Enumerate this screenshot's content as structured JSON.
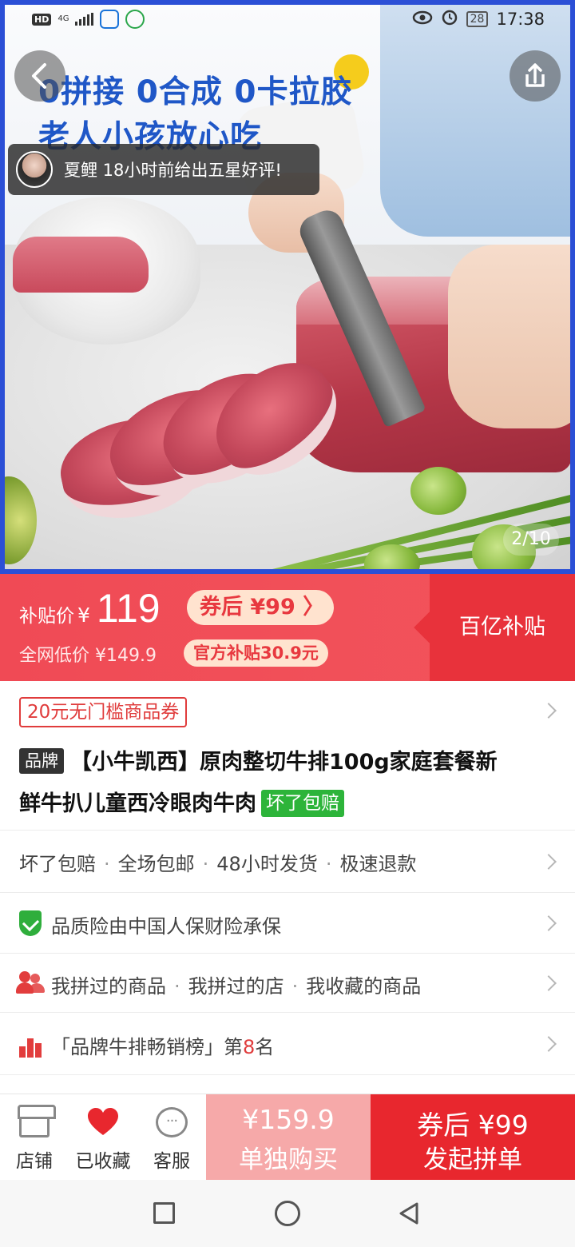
{
  "status_bar": {
    "hd": "HD",
    "network": "4G",
    "battery": "28",
    "time": "17:38"
  },
  "hero": {
    "title_line1": "0拼接 0合成 0卡拉胶",
    "title_line2": "老人小孩放心吃",
    "review": "夏鲤 18小时前给出五星好评!",
    "counter": "2/10"
  },
  "price": {
    "label": "补贴价",
    "currency": "¥",
    "value": "119",
    "coupon_after": "券后 ¥99 〉",
    "market_price": "全网低价 ¥149.9",
    "subsidy": "官方补贴30.9元",
    "campaign": "百亿补贴"
  },
  "coupon": {
    "label": "20元无门槛商品券"
  },
  "product": {
    "brand_tag": "品牌",
    "title_line1": "【小牛凯西】原肉整切牛排100g家庭套餐新",
    "title_line2": "鲜牛扒儿童西冷眼肉牛肉",
    "guarantee_tag": "坏了包赔"
  },
  "services": [
    "坏了包赔",
    "全场包邮",
    "48小时发货",
    "极速退款"
  ],
  "insurance": "品质险由中国人保财险承保",
  "history": [
    "我拼过的商品",
    "我拼过的店",
    "我收藏的商品"
  ],
  "ranking": {
    "prefix": "「品牌牛排畅销榜」第",
    "rank": "8",
    "suffix": "名"
  },
  "bottom_bar": {
    "store": "店铺",
    "favorited": "已收藏",
    "service": "客服",
    "single_price": "¥159.9",
    "single_label": "单独购买",
    "group_price": "券后 ¥99",
    "group_label": "发起拼单"
  },
  "colors": {
    "accent_red": "#e8272e",
    "price_banner": "#f04a55",
    "green_tag": "#2db43a",
    "hero_border": "#2b4fd6"
  }
}
